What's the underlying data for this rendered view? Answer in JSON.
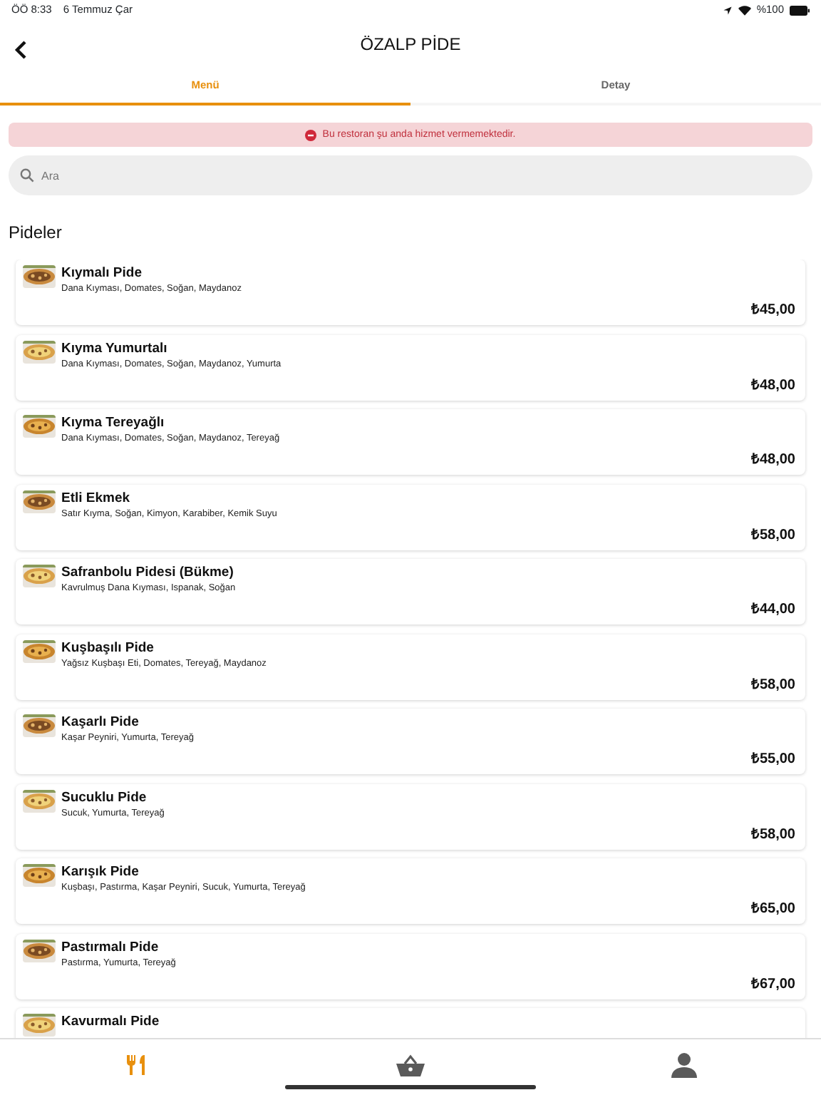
{
  "status_bar": {
    "time": "ÖÖ 8:33",
    "date": "6 Temmuz Çar",
    "battery": "%100"
  },
  "header": {
    "title": "ÖZALP PİDE"
  },
  "tabs": [
    {
      "label": "Menü",
      "selected": true
    },
    {
      "label": "Detay",
      "selected": false
    }
  ],
  "alert": {
    "message": "Bu restoran şu anda hizmet vermemektedir."
  },
  "search": {
    "placeholder": "Ara"
  },
  "section_title": "Pideler",
  "items": [
    {
      "name": "Kıymalı Pide",
      "description": "Dana Kıyması, Domates, Soğan, Maydanoz",
      "price": "₺45,00"
    },
    {
      "name": "Kıyma Yumurtalı",
      "description": "Dana Kıyması, Domates, Soğan, Maydanoz, Yumurta",
      "price": "₺48,00"
    },
    {
      "name": "Kıyma Tereyağlı",
      "description": "Dana Kıyması, Domates, Soğan, Maydanoz, Tereyağ",
      "price": "₺48,00"
    },
    {
      "name": "Etli Ekmek",
      "description": "Satır Kıyma, Soğan, Kimyon, Karabiber, Kemik Suyu",
      "price": "₺58,00"
    },
    {
      "name": "Safranbolu Pidesi (Bükme)",
      "description": "Kavrulmuş Dana Kıyması, Ispanak, Soğan",
      "price": "₺44,00"
    },
    {
      "name": "Kuşbaşılı Pide",
      "description": "Yağsız Kuşbaşı Eti, Domates, Tereyağ, Maydanoz",
      "price": "₺58,00"
    },
    {
      "name": "Kaşarlı Pide",
      "description": "Kaşar Peyniri, Yumurta, Tereyağ",
      "price": "₺55,00"
    },
    {
      "name": "Sucuklu Pide",
      "description": "Sucuk, Yumurta, Tereyağ",
      "price": "₺58,00"
    },
    {
      "name": "Karışık Pide",
      "description": "Kuşbaşı, Pastırma, Kaşar Peyniri, Sucuk, Yumurta, Tereyağ",
      "price": "₺65,00"
    },
    {
      "name": "Pastırmalı Pide",
      "description": "Pastırma, Yumurta, Tereyağ",
      "price": "₺67,00"
    },
    {
      "name": "Kavurmalı Pide"
    }
  ],
  "bottom_nav": [
    {
      "kind": "menu",
      "selected": true
    },
    {
      "kind": "basket",
      "selected": false
    },
    {
      "kind": "profile",
      "selected": false
    }
  ]
}
